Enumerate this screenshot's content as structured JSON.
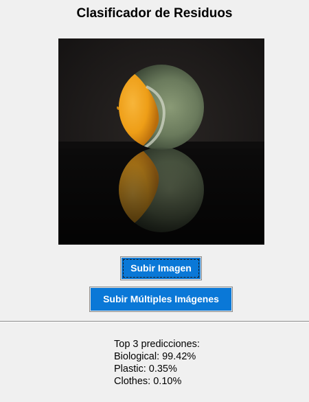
{
  "window": {
    "title": "Clasificador de Residuos"
  },
  "preview": {
    "description_icon": "moldy-lemon-photo"
  },
  "buttons": {
    "upload_single": "Subir Imagen",
    "upload_multiple": "Subir Múltiples Imágenes"
  },
  "results": {
    "header": "Top 3 predicciones:",
    "items": [
      "Biological: 99.42%",
      "Plastic: 0.35%",
      "Clothes: 0.10%"
    ]
  },
  "colors": {
    "background": "#f0f0f0",
    "button": "#0a78d7",
    "button_text": "#ffffff"
  }
}
